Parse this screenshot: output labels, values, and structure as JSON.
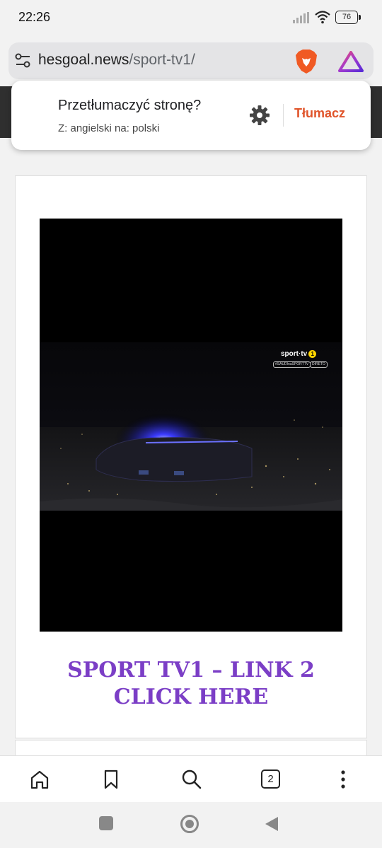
{
  "status_bar": {
    "time": "22:26",
    "battery": "76",
    "icons": [
      "signal-icon",
      "wifi-icon",
      "battery-icon"
    ]
  },
  "address_bar": {
    "domain": "hesgoal.news",
    "path": "/sport-tv1/",
    "icons": [
      "tune-icon",
      "brave-lion-icon",
      "brave-rewards-icon"
    ]
  },
  "translate_popup": {
    "question": "Przetłumaczyć stronę?",
    "languages": "Z: angielski na: polski",
    "action_label": "Tłumacz",
    "action_color": "#e0542a"
  },
  "video": {
    "channel_logo": "sport·tv",
    "channel_number": "1",
    "hashtag": "#SAUDInaSPORTTV",
    "live_label": "DIRETO"
  },
  "content": {
    "link_line1": "SPORT TV1 – LINK 2",
    "link_line2": "CLICK HERE",
    "link_color": "#7b3ec6"
  },
  "toolbar": {
    "tab_count": "2",
    "icons": [
      "home-icon",
      "bookmark-icon",
      "search-icon",
      "tabs-icon",
      "more-icon"
    ]
  },
  "nav_bar": {
    "icons": [
      "recents-icon",
      "home-nav-icon",
      "back-icon"
    ]
  }
}
